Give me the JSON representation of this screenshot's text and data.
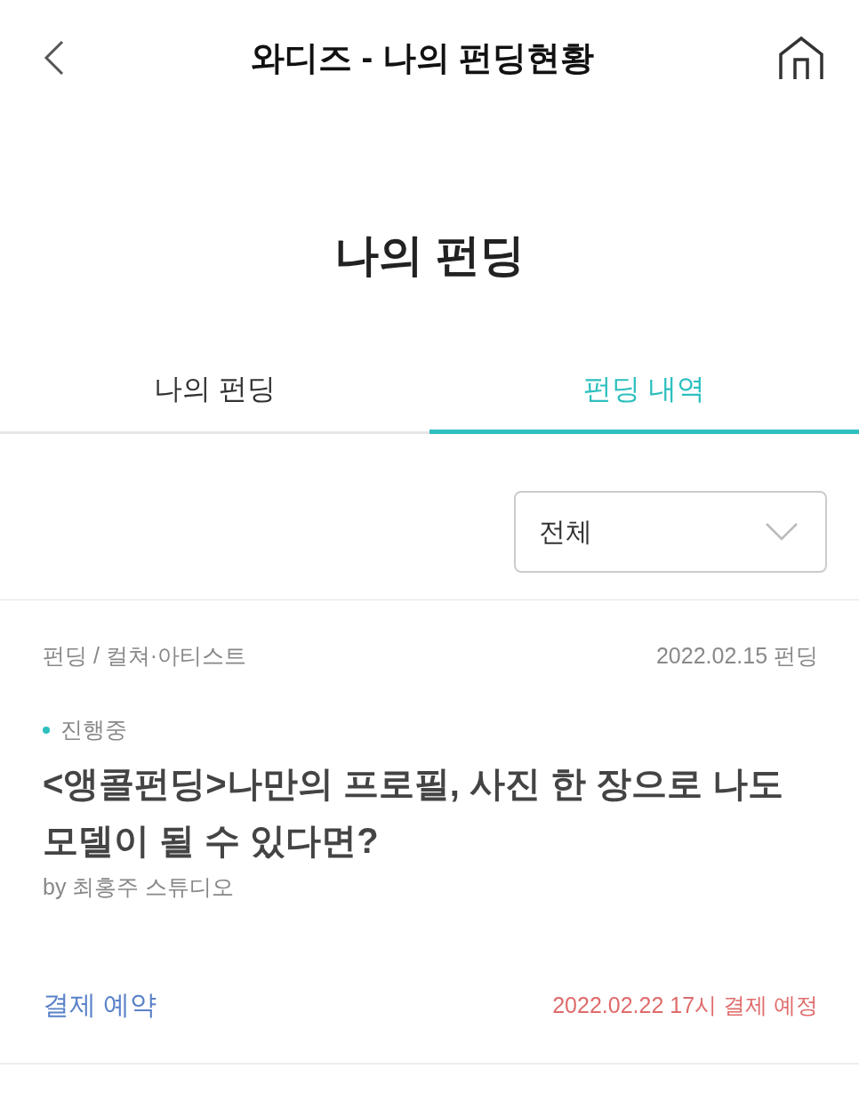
{
  "header": {
    "title": "와디즈 - 나의 펀딩현황"
  },
  "page_title": "나의 펀딩",
  "tabs": [
    {
      "label": "나의 펀딩",
      "selected": false
    },
    {
      "label": "펀딩 내역",
      "selected": true
    }
  ],
  "filter": {
    "value": "전체"
  },
  "fundings": [
    {
      "category": "펀딩 / 컬쳐·아티스트",
      "date": "2022.02.15 펀딩",
      "status": "진행중",
      "title": "<앵콜펀딩>나만의 프로필, 사진 한 장으로 나도 모델이 될 수 있다면?",
      "maker": "by 최홍주 스튜디오",
      "payment_label": "결제 예약",
      "payment_date": "2022.02.22 17시 결제 예정"
    }
  ]
}
